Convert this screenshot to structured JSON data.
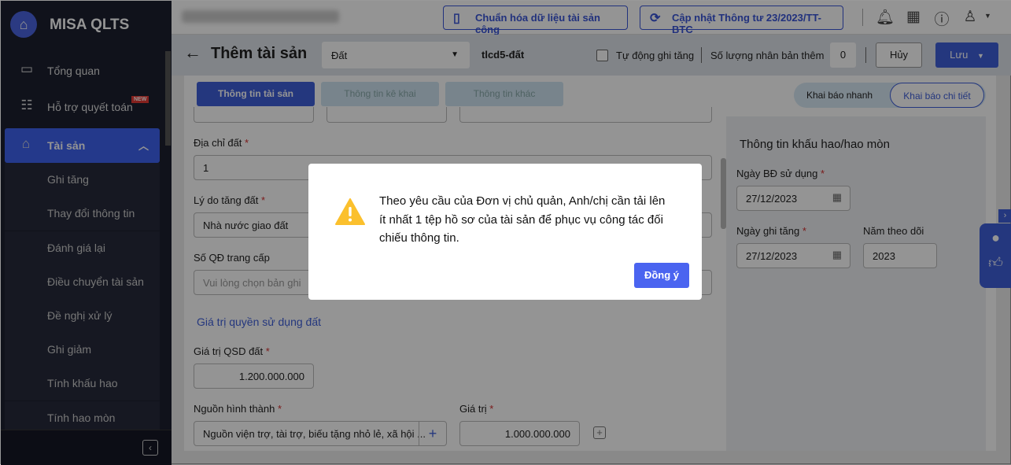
{
  "app": {
    "name": "MISA QLTS"
  },
  "sidebar": {
    "items": [
      {
        "label": "Tổng quan",
        "icon": "monitor-chart-icon"
      },
      {
        "label": "Hỗ trợ quyết toán",
        "icon": "clipboard-icon",
        "badge": "NEW"
      },
      {
        "label": "Tài sản",
        "icon": "house-car-icon",
        "active": true
      }
    ],
    "sub_items": [
      "Ghi tăng",
      "Thay đổi thông tin",
      "Đánh giá lại",
      "Điều chuyển tài sản",
      "Đề nghị xử lý",
      "Ghi giảm",
      "Tính khấu hao",
      "Tính hao mòn"
    ]
  },
  "topbar": {
    "btn_standardize": "Chuẩn hóa dữ liệu tài sản công",
    "btn_update": "Cập nhật Thông tư 23/2023/TT-BTC"
  },
  "header": {
    "title": "Thêm tài sản",
    "asset_type": "Đất",
    "code": "tlcd5-đất",
    "auto_label": "Tự động ghi tăng",
    "copies_label": "Số lượng nhân bản thêm",
    "copies_value": "0",
    "cancel": "Hủy",
    "save": "Lưu"
  },
  "tabs": [
    "Thông tin tài sản",
    "Thông tin kê khai",
    "Thông tin khác"
  ],
  "mode": {
    "quick": "Khai báo nhanh",
    "detail": "Khai báo chi tiết"
  },
  "form": {
    "address_label": "Địa chỉ đất",
    "address_value": "1",
    "reason_label": "Lý do tăng đất",
    "reason_value": "Nhà nước giao đất",
    "decision_label": "Số QĐ trang cấp",
    "decision_placeholder": "Vui lòng chọn bản ghi",
    "section": "Giá trị quyền sử dụng đất",
    "qsd_label": "Giá trị QSD đất",
    "qsd_value": "1.200.000.000",
    "source_label": "Nguồn hình thành",
    "source_value": "Nguồn viện trợ, tài trợ, biếu tặng nhỏ lẻ, xã hội ...",
    "value_label": "Giá trị",
    "value_value": "1.000.000.000"
  },
  "depreciation": {
    "title": "Thông tin khấu hao/hao mòn",
    "start_label": "Ngày BĐ sử dụng",
    "start_value": "27/12/2023",
    "inc_label": "Ngày ghi tăng",
    "inc_value": "27/12/2023",
    "year_label": "Năm theo dõi",
    "year_value": "2023"
  },
  "dialog": {
    "message": "Theo yêu cầu của Đơn vị chủ quản, Anh/chị cần tải lên ít nhất 1 tệp hồ sơ của tài sản để phục vụ công tác đối chiếu thông tin.",
    "ok": "Đồng ý",
    "icon": "warning-icon",
    "icon_color": "#fbc02d"
  },
  "colors": {
    "primary": "#3f5fd9",
    "sidebar": "#1d2030"
  }
}
